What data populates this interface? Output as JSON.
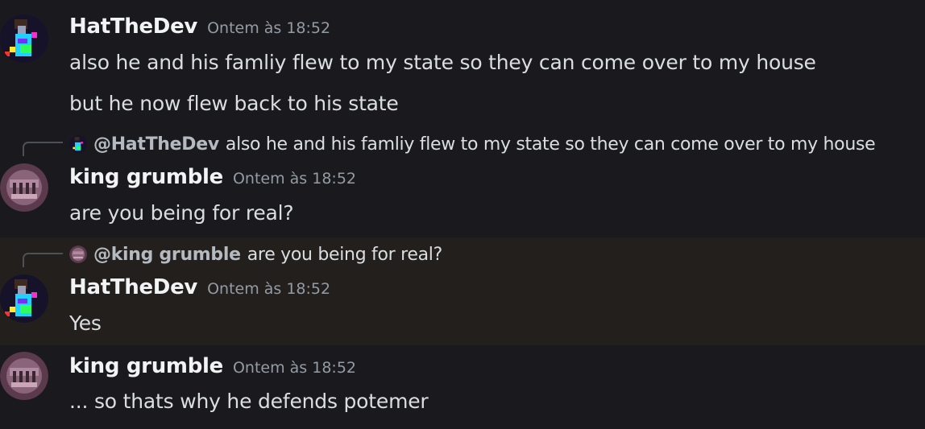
{
  "messages": [
    {
      "author": "HatTheDev",
      "timestamp": "Ontem às 18:52",
      "lines": [
        "also he and his famliy flew to my state so they can come over to my house",
        "but he now flew back to his state"
      ]
    },
    {
      "reply": {
        "name": "@HatTheDev",
        "text": "also he and his famliy flew to my state so they can come over to my house"
      },
      "author": "king grumble",
      "timestamp": "Ontem às 18:52",
      "lines": [
        "are you being for real?"
      ]
    },
    {
      "reply": {
        "name": "@king grumble",
        "text": "are you being for real?"
      },
      "author": "HatTheDev",
      "timestamp": "Ontem às 18:52",
      "lines": [
        "Yes"
      ]
    },
    {
      "author": "king grumble",
      "timestamp": "Ontem às 18:52",
      "lines": [
        "... so thats why he defends potemer"
      ]
    }
  ],
  "colors": {
    "background": "#1a1a1e",
    "highlight": "#221f1c",
    "username": "#f2f3f5",
    "timestamp": "#949ba4",
    "text": "#dbdee1"
  }
}
